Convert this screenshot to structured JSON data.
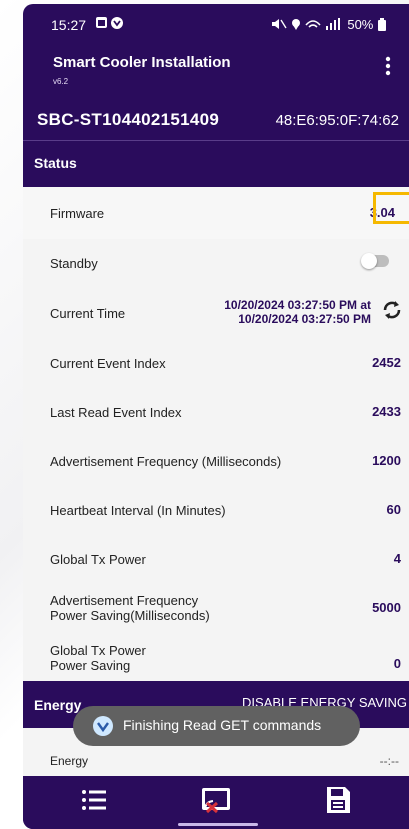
{
  "status_bar": {
    "time": "15:27",
    "right": "50%"
  },
  "app": {
    "title": "Smart Cooler Installation",
    "version": "v6.2",
    "menu_icon": "more-vert-icon"
  },
  "device": {
    "id": "SBC-ST104402151409",
    "mac": "48:E6:95:0F:74:62"
  },
  "status_section": {
    "title": "Status",
    "rows": [
      {
        "label": "Firmware",
        "value": "3.04"
      },
      {
        "label": "Standby",
        "toggle_on": false
      },
      {
        "label": "Current Time",
        "value_line1": "10/20/2024 03:27:50 PM at",
        "value_line2": "10/20/2024 03:27:50 PM",
        "action_icon": "refresh-icon"
      },
      {
        "label": "Current Event Index",
        "value": "2452"
      },
      {
        "label": "Last Read Event Index",
        "value": "2433"
      },
      {
        "label": "Advertisement Frequency (Milliseconds)",
        "value": "1200"
      },
      {
        "label": "Heartbeat Interval (In Minutes)",
        "value": "60"
      },
      {
        "label": "Global Tx Power",
        "value": "4"
      },
      {
        "label_line1": "Advertisement Frequency",
        "label_line2": "Power Saving(Milliseconds)",
        "value": "5000"
      },
      {
        "label_line1": "Global Tx Power",
        "label_line2": "Power Saving",
        "value": "0"
      }
    ]
  },
  "energy_section": {
    "title": "Energy",
    "action": "DISABLE ENERGY SAVING",
    "row_label": "Energy",
    "row_value": "--:--"
  },
  "toast": {
    "message": "Finishing Read GET commands"
  },
  "nav": {
    "items": [
      "list-icon",
      "cast-off-icon",
      "save-icon"
    ]
  },
  "colors": {
    "primary": "#2a0c5c",
    "highlight": "#f5b800"
  }
}
